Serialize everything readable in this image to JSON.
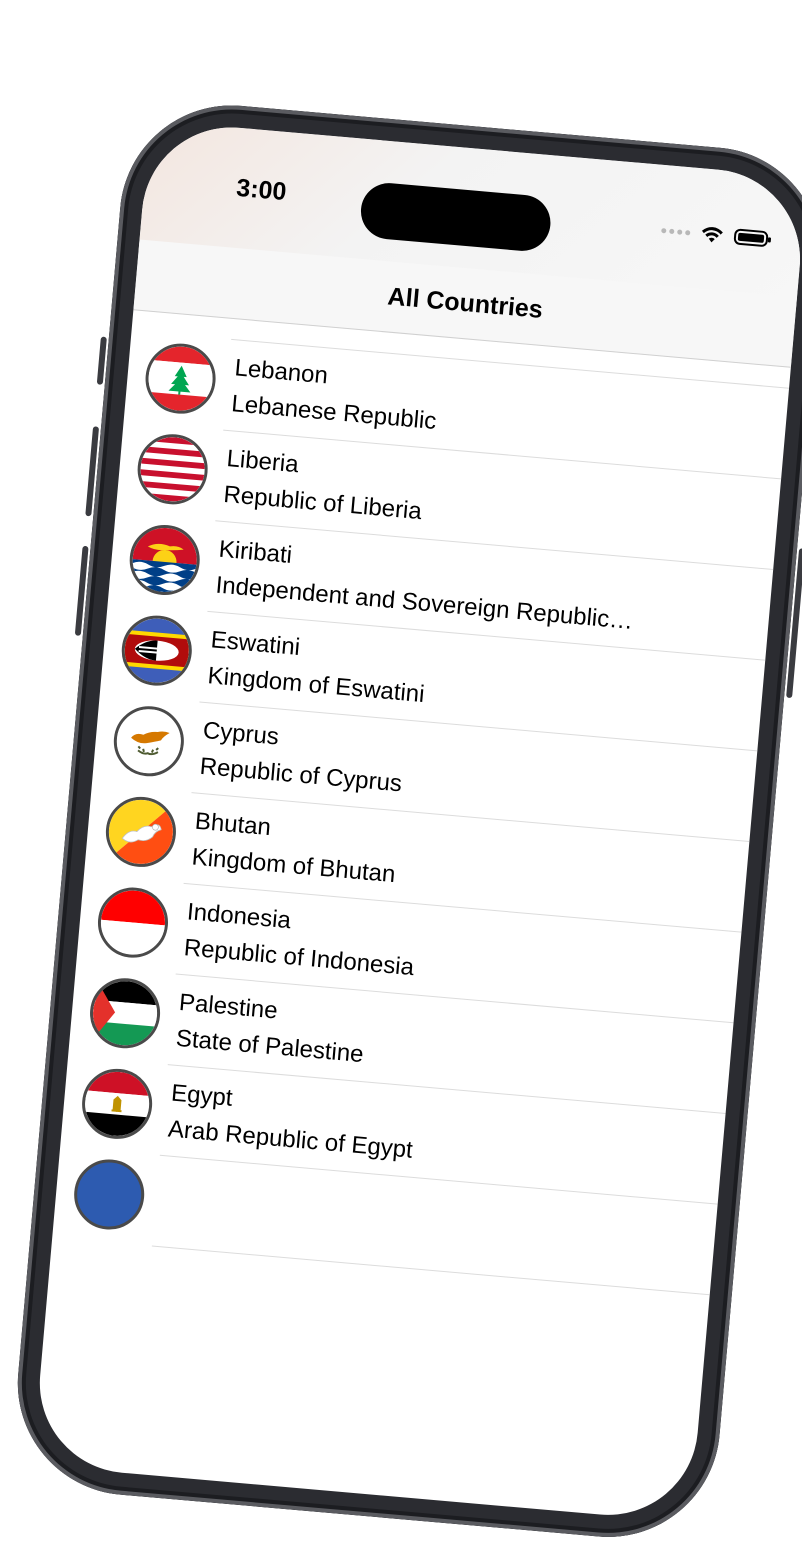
{
  "status_bar": {
    "time": "3:00"
  },
  "nav": {
    "title": "All Countries"
  },
  "countries": [
    {
      "name": "Lebanon",
      "official": "Lebanese Republic",
      "flag_icon": "lebanon-flag-icon"
    },
    {
      "name": "Liberia",
      "official": "Republic of Liberia",
      "flag_icon": "liberia-flag-icon"
    },
    {
      "name": "Kiribati",
      "official": "Independent and Sovereign Republic…",
      "flag_icon": "kiribati-flag-icon"
    },
    {
      "name": "Eswatini",
      "official": "Kingdom of Eswatini",
      "flag_icon": "eswatini-flag-icon"
    },
    {
      "name": "Cyprus",
      "official": "Republic of Cyprus",
      "flag_icon": "cyprus-flag-icon"
    },
    {
      "name": "Bhutan",
      "official": "Kingdom of Bhutan",
      "flag_icon": "bhutan-flag-icon"
    },
    {
      "name": "Indonesia",
      "official": "Republic of Indonesia",
      "flag_icon": "indonesia-flag-icon"
    },
    {
      "name": "Palestine",
      "official": "State of Palestine",
      "flag_icon": "palestine-flag-icon"
    },
    {
      "name": "Egypt",
      "official": "Arab Republic of Egypt",
      "flag_icon": "egypt-flag-icon"
    }
  ]
}
